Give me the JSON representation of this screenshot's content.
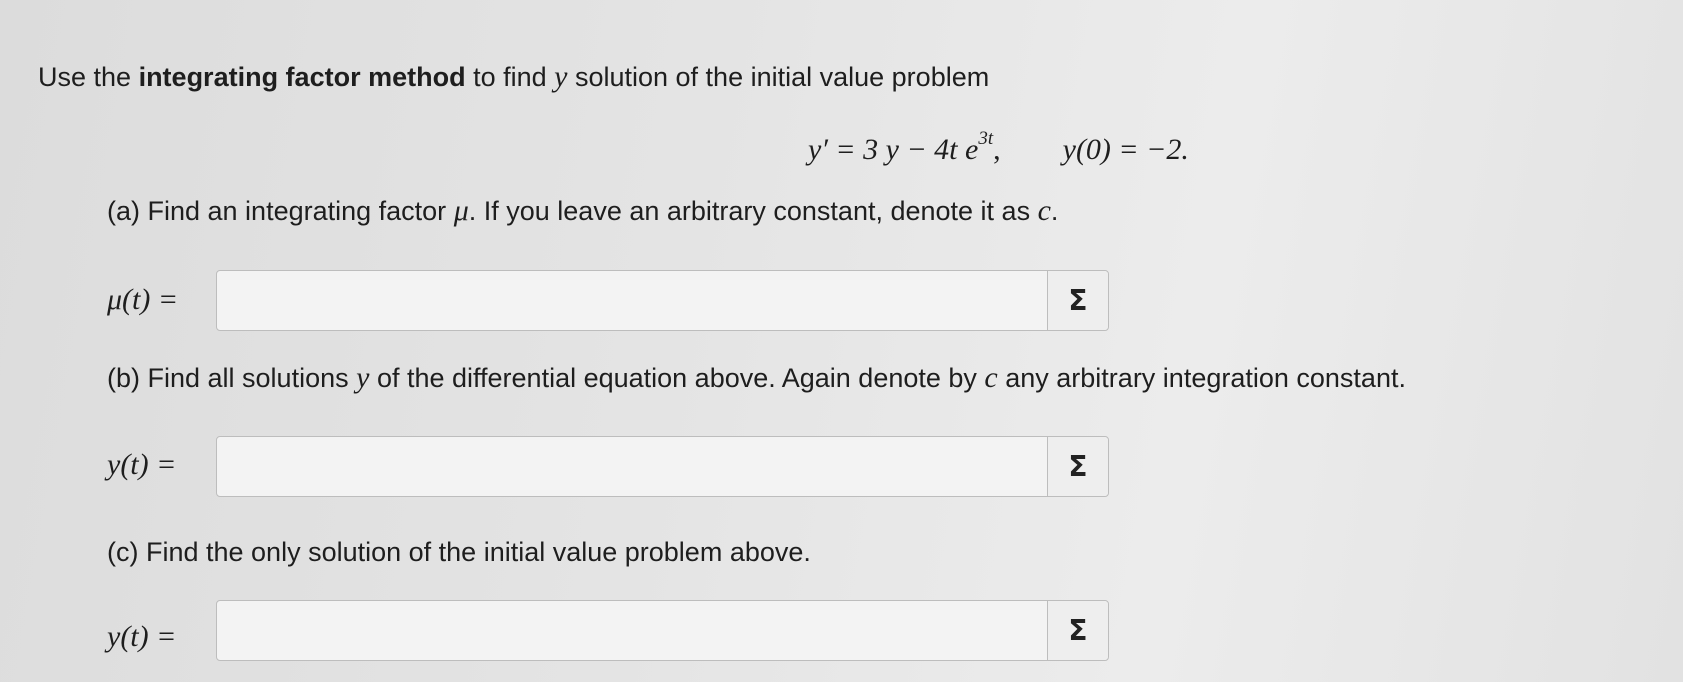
{
  "intro": {
    "prefix": "Use the ",
    "bold": "integrating factor method",
    "middle": " to find ",
    "var": "y",
    "suffix": " solution of the initial value problem"
  },
  "equation": {
    "lhs": "y′ = 3 y − 4t e",
    "exponent": "3t",
    "comma": ",",
    "initial": "y(0) = −2."
  },
  "part_a": {
    "prefix": "(a) Find an integrating factor ",
    "mu": "μ",
    "suffix": ". If you leave an arbitrary constant, denote it as ",
    "c": "c",
    "end": ".",
    "label": "μ(t) ="
  },
  "part_b": {
    "prefix": "(b) Find all solutions ",
    "y": "y",
    "middle": " of the differential equation above. Again denote by ",
    "c": "c",
    "suffix": " any arbitrary integration constant.",
    "label": "y(t) ="
  },
  "part_c": {
    "text": "(c) Find the only solution of the initial value problem above.",
    "label": "y(t) ="
  },
  "sigma_label": "Σ",
  "answers": {
    "a": "",
    "b": "",
    "c": ""
  }
}
